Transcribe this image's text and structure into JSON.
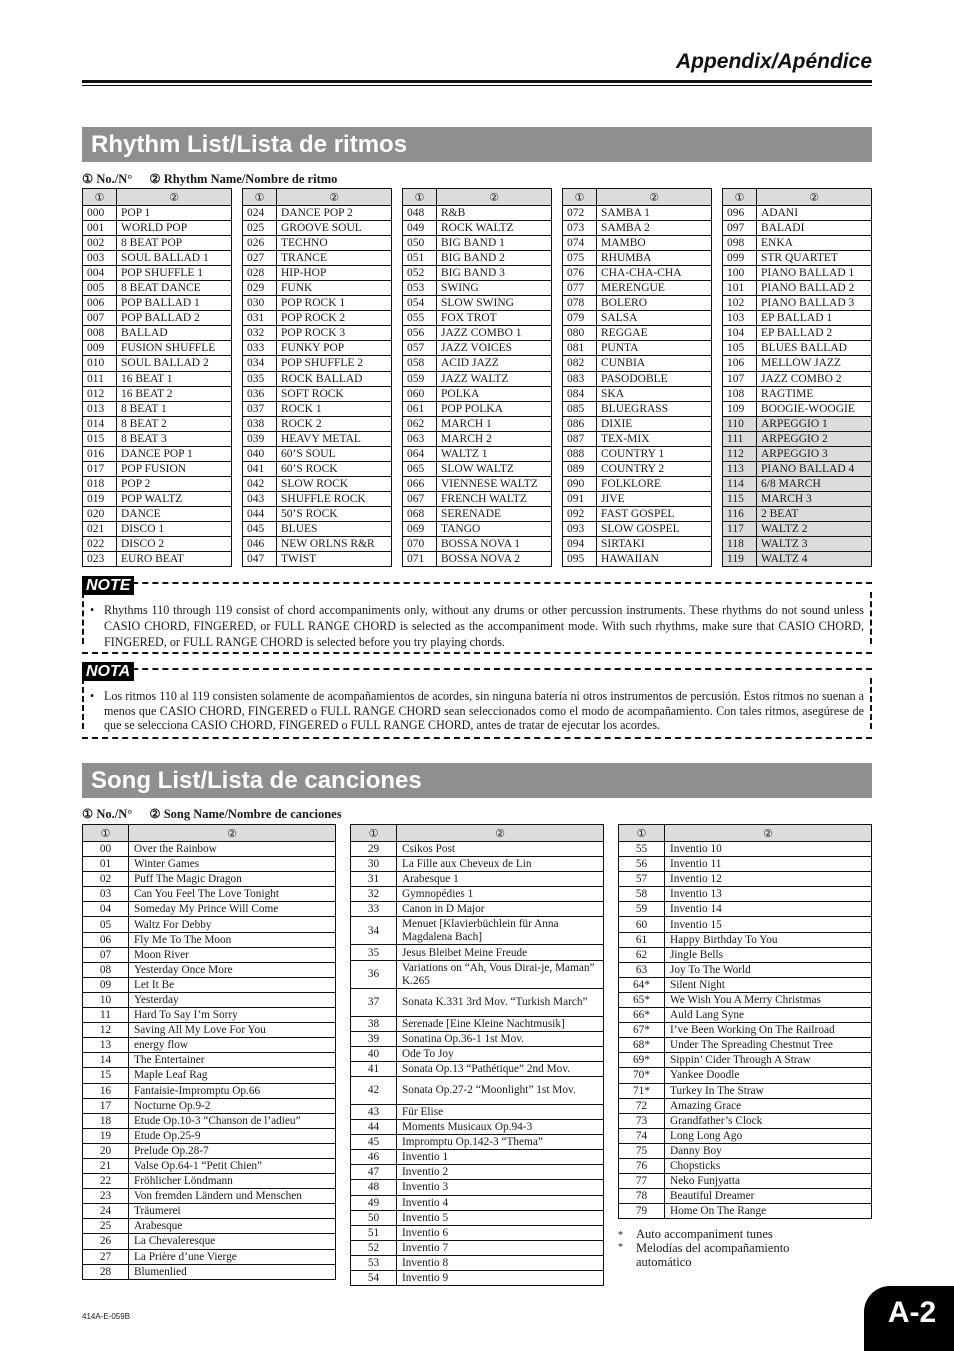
{
  "header": {
    "title": "Appendix/Apéndice"
  },
  "rhythm_section": {
    "title": "Rhythm List/Lista de ritmos",
    "legend_no": "① No./N°",
    "legend_name": "② Rhythm Name/Nombre de ritmo",
    "col_no": "①",
    "col_name": "②",
    "shaded_from": "110",
    "columns": [
      [
        [
          "000",
          "POP 1"
        ],
        [
          "001",
          "WORLD POP"
        ],
        [
          "002",
          "8 BEAT POP"
        ],
        [
          "003",
          "SOUL BALLAD 1"
        ],
        [
          "004",
          "POP SHUFFLE 1"
        ],
        [
          "005",
          "8 BEAT DANCE"
        ],
        [
          "006",
          "POP BALLAD 1"
        ],
        [
          "007",
          "POP BALLAD 2"
        ],
        [
          "008",
          "BALLAD"
        ],
        [
          "009",
          "FUSION SHUFFLE"
        ],
        [
          "010",
          "SOUL BALLAD 2"
        ],
        [
          "011",
          "16 BEAT 1"
        ],
        [
          "012",
          "16 BEAT 2"
        ],
        [
          "013",
          "8 BEAT 1"
        ],
        [
          "014",
          "8 BEAT 2"
        ],
        [
          "015",
          "8 BEAT 3"
        ],
        [
          "016",
          "DANCE POP 1"
        ],
        [
          "017",
          "POP FUSION"
        ],
        [
          "018",
          "POP 2"
        ],
        [
          "019",
          "POP WALTZ"
        ],
        [
          "020",
          "DANCE"
        ],
        [
          "021",
          "DISCO 1"
        ],
        [
          "022",
          "DISCO 2"
        ],
        [
          "023",
          "EURO BEAT"
        ]
      ],
      [
        [
          "024",
          "DANCE POP 2"
        ],
        [
          "025",
          "GROOVE SOUL"
        ],
        [
          "026",
          "TECHNO"
        ],
        [
          "027",
          "TRANCE"
        ],
        [
          "028",
          "HIP-HOP"
        ],
        [
          "029",
          "FUNK"
        ],
        [
          "030",
          "POP ROCK 1"
        ],
        [
          "031",
          "POP ROCK 2"
        ],
        [
          "032",
          "POP ROCK 3"
        ],
        [
          "033",
          "FUNKY POP"
        ],
        [
          "034",
          "POP SHUFFLE 2"
        ],
        [
          "035",
          "ROCK BALLAD"
        ],
        [
          "036",
          "SOFT ROCK"
        ],
        [
          "037",
          "ROCK 1"
        ],
        [
          "038",
          "ROCK 2"
        ],
        [
          "039",
          "HEAVY METAL"
        ],
        [
          "040",
          "60’S SOUL"
        ],
        [
          "041",
          "60’S ROCK"
        ],
        [
          "042",
          "SLOW ROCK"
        ],
        [
          "043",
          "SHUFFLE ROCK"
        ],
        [
          "044",
          "50’S ROCK"
        ],
        [
          "045",
          "BLUES"
        ],
        [
          "046",
          "NEW ORLNS R&R"
        ],
        [
          "047",
          "TWIST"
        ]
      ],
      [
        [
          "048",
          "R&B"
        ],
        [
          "049",
          "ROCK WALTZ"
        ],
        [
          "050",
          "BIG BAND 1"
        ],
        [
          "051",
          "BIG BAND 2"
        ],
        [
          "052",
          "BIG BAND 3"
        ],
        [
          "053",
          "SWING"
        ],
        [
          "054",
          "SLOW SWING"
        ],
        [
          "055",
          "FOX TROT"
        ],
        [
          "056",
          "JAZZ COMBO 1"
        ],
        [
          "057",
          "JAZZ VOICES"
        ],
        [
          "058",
          "ACID JAZZ"
        ],
        [
          "059",
          "JAZZ WALTZ"
        ],
        [
          "060",
          "POLKA"
        ],
        [
          "061",
          "POP POLKA"
        ],
        [
          "062",
          "MARCH 1"
        ],
        [
          "063",
          "MARCH 2"
        ],
        [
          "064",
          "WALTZ 1"
        ],
        [
          "065",
          "SLOW WALTZ"
        ],
        [
          "066",
          "VIENNESE WALTZ"
        ],
        [
          "067",
          "FRENCH WALTZ"
        ],
        [
          "068",
          "SERENADE"
        ],
        [
          "069",
          "TANGO"
        ],
        [
          "070",
          "BOSSA NOVA 1"
        ],
        [
          "071",
          "BOSSA NOVA 2"
        ]
      ],
      [
        [
          "072",
          "SAMBA 1"
        ],
        [
          "073",
          "SAMBA 2"
        ],
        [
          "074",
          "MAMBO"
        ],
        [
          "075",
          "RHUMBA"
        ],
        [
          "076",
          "CHA-CHA-CHA"
        ],
        [
          "077",
          "MERENGUE"
        ],
        [
          "078",
          "BOLERO"
        ],
        [
          "079",
          "SALSA"
        ],
        [
          "080",
          "REGGAE"
        ],
        [
          "081",
          "PUNTA"
        ],
        [
          "082",
          "CUNBIA"
        ],
        [
          "083",
          "PASODOBLE"
        ],
        [
          "084",
          "SKA"
        ],
        [
          "085",
          "BLUEGRASS"
        ],
        [
          "086",
          "DIXIE"
        ],
        [
          "087",
          "TEX-MIX"
        ],
        [
          "088",
          "COUNTRY 1"
        ],
        [
          "089",
          "COUNTRY 2"
        ],
        [
          "090",
          "FOLKLORE"
        ],
        [
          "091",
          "JIVE"
        ],
        [
          "092",
          "FAST GOSPEL"
        ],
        [
          "093",
          "SLOW GOSPEL"
        ],
        [
          "094",
          "SIRTAKI"
        ],
        [
          "095",
          "HAWAIIAN"
        ]
      ],
      [
        [
          "096",
          "ADANI"
        ],
        [
          "097",
          "BALADI"
        ],
        [
          "098",
          "ENKA"
        ],
        [
          "099",
          "STR QUARTET"
        ],
        [
          "100",
          "PIANO BALLAD 1"
        ],
        [
          "101",
          "PIANO BALLAD 2"
        ],
        [
          "102",
          "PIANO BALLAD 3"
        ],
        [
          "103",
          "EP BALLAD 1"
        ],
        [
          "104",
          "EP BALLAD 2"
        ],
        [
          "105",
          "BLUES BALLAD"
        ],
        [
          "106",
          "MELLOW JAZZ"
        ],
        [
          "107",
          "JAZZ COMBO 2"
        ],
        [
          "108",
          "RAGTIME"
        ],
        [
          "109",
          "BOOGIE-WOOGIE"
        ],
        [
          "110",
          "ARPEGGIO 1"
        ],
        [
          "111",
          "ARPEGGIO 2"
        ],
        [
          "112",
          "ARPEGGIO 3"
        ],
        [
          "113",
          "PIANO BALLAD 4"
        ],
        [
          "114",
          "6/8 MARCH"
        ],
        [
          "115",
          "MARCH 3"
        ],
        [
          "116",
          "2 BEAT"
        ],
        [
          "117",
          "WALTZ 2"
        ],
        [
          "118",
          "WALTZ 3"
        ],
        [
          "119",
          "WALTZ 4"
        ]
      ]
    ]
  },
  "notes": {
    "note_label": "NOTE",
    "note_bullet": "•",
    "note_text": "Rhythms 110 through 119 consist of chord accompaniments only, without any drums or other percussion instruments. These rhythms do not sound unless CASIO CHORD, FINGERED, or FULL RANGE CHORD is selected as the accompaniment mode. With such rhythms, make sure that CASIO CHORD, FINGERED, or FULL RANGE CHORD is selected before you try playing chords.",
    "nota_label": "NOTA",
    "nota_text": "Los ritmos 110 al 119 consisten solamente de acompañamientos de acordes, sin ninguna batería ni otros instrumentos de percusión. Estos ritmos no suenan a menos que CASIO CHORD, FINGERED o FULL RANGE CHORD sean seleccionados como el modo de acompañamiento. Con tales ritmos, asegúrese de que se selecciona CASIO CHORD, FINGERED o FULL RANGE CHORD, antes de tratar de ejecutar los acordes."
  },
  "song_section": {
    "title": "Song List/Lista de canciones",
    "legend_no": "① No./N°",
    "legend_name": "② Song Name/Nombre de canciones",
    "col_no": "①",
    "col_name": "②",
    "columns": [
      [
        [
          "00",
          "Over the Rainbow"
        ],
        [
          "01",
          "Winter Games"
        ],
        [
          "02",
          "Puff The Magic Dragon"
        ],
        [
          "03",
          "Can You Feel The Love Tonight"
        ],
        [
          "04",
          "Someday My Prince Will Come"
        ],
        [
          "05",
          "Waltz For Debby"
        ],
        [
          "06",
          "Fly Me To The Moon"
        ],
        [
          "07",
          "Moon River"
        ],
        [
          "08",
          "Yesterday Once More"
        ],
        [
          "09",
          "Let It Be"
        ],
        [
          "10",
          "Yesterday"
        ],
        [
          "11",
          "Hard To Say I’m Sorry"
        ],
        [
          "12",
          "Saving All My Love For You"
        ],
        [
          "13",
          "energy flow"
        ],
        [
          "14",
          "The Entertainer"
        ],
        [
          "15",
          "Maple Leaf Rag"
        ],
        [
          "16",
          "Fantaisie-Impromptu Op.66"
        ],
        [
          "17",
          "Nocturne Op.9-2"
        ],
        [
          "18",
          "Etude Op.10-3 “Chanson de l’adieu”"
        ],
        [
          "19",
          "Etude Op.25-9"
        ],
        [
          "20",
          "Prelude Op.28-7"
        ],
        [
          "21",
          "Valse Op.64-1 “Petit Chien”"
        ],
        [
          "22",
          "Fröhlicher Löndmann"
        ],
        [
          "23",
          "Von fremden Ländern und Menschen"
        ],
        [
          "24",
          "Träumerei"
        ],
        [
          "25",
          "Arabesque"
        ],
        [
          "26",
          "La Chevaleresque"
        ],
        [
          "27",
          "La Prière d’une Vierge"
        ],
        [
          "28",
          "Blumenlied"
        ]
      ],
      [
        [
          "29",
          "Csikos Post"
        ],
        [
          "30",
          "La Fille aux Cheveux de Lin"
        ],
        [
          "31",
          "Arabesque 1"
        ],
        [
          "32",
          "Gymnopédies 1"
        ],
        [
          "33",
          "Canon in D Major"
        ],
        [
          "34",
          "Menuet  [Klavierbüchlein für Anna Magdalena Bach]"
        ],
        [
          "35",
          "Jesus Bleibet Meine Freude"
        ],
        [
          "36",
          "Variations on “Ah, Vous Dirai-je, Maman” K.265"
        ],
        [
          "37",
          "Sonata K.331 3rd Mov. “Turkish March”"
        ],
        [
          "38",
          "Serenade [Eine Kleine Nachtmusik]"
        ],
        [
          "39",
          "Sonatina Op.36-1 1st Mov."
        ],
        [
          "40",
          "Ode To Joy"
        ],
        [
          "41",
          "Sonata Op.13 “Pathétique” 2nd Mov."
        ],
        [
          "42",
          "Sonata Op.27-2 “Moonlight” 1st Mov."
        ],
        [
          "43",
          "Für Elise"
        ],
        [
          "44",
          "Moments Musicaux Op.94-3"
        ],
        [
          "45",
          "Impromptu Op.142-3 “Thema”"
        ],
        [
          "46",
          "Inventio 1"
        ],
        [
          "47",
          "Inventio 2"
        ],
        [
          "48",
          "Inventio 3"
        ],
        [
          "49",
          "Inventio 4"
        ],
        [
          "50",
          "Inventio 5"
        ],
        [
          "51",
          "Inventio 6"
        ],
        [
          "52",
          "Inventio 7"
        ],
        [
          "53",
          "Inventio 8"
        ],
        [
          "54",
          "Inventio 9"
        ]
      ],
      [
        [
          "55",
          "Inventio 10"
        ],
        [
          "56",
          "Inventio 11"
        ],
        [
          "57",
          "Inventio 12"
        ],
        [
          "58",
          "Inventio 13"
        ],
        [
          "59",
          "Inventio 14"
        ],
        [
          "60",
          "Inventio 15"
        ],
        [
          "61",
          "Happy Birthday To You"
        ],
        [
          "62",
          "Jingle Bells"
        ],
        [
          "63",
          "Joy To The World"
        ],
        [
          "64*",
          "Silent Night"
        ],
        [
          "65*",
          "We Wish You A Merry Christmas"
        ],
        [
          "66*",
          "Auld Lang Syne"
        ],
        [
          "67*",
          "I’ve Been Working On The Railroad"
        ],
        [
          "68*",
          "Under The Spreading Chestnut Tree"
        ],
        [
          "69*",
          "Sippin’ Cider Through A Straw"
        ],
        [
          "70*",
          "Yankee Doodle"
        ],
        [
          "71*",
          "Turkey In The Straw"
        ],
        [
          "72",
          "Amazing Grace"
        ],
        [
          "73",
          "Grandfather’s Clock"
        ],
        [
          "74",
          "Long Long Ago"
        ],
        [
          "75",
          "Danny Boy"
        ],
        [
          "76",
          "Chopsticks"
        ],
        [
          "77",
          "Neko Funjyatta"
        ],
        [
          "78",
          "Beautiful Dreamer"
        ],
        [
          "79",
          "Home On The Range"
        ]
      ]
    ],
    "footnote_mark": "*",
    "footnote_en": "Auto accompaniment tunes",
    "footnote_es": "Melodías del acompañamiento automático"
  },
  "footer": {
    "code": "414A-E-059B",
    "page": "A-2"
  }
}
